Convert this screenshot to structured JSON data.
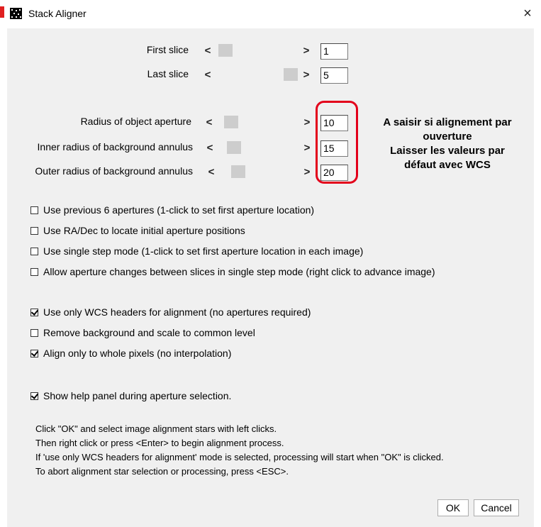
{
  "window": {
    "title": "Stack Aligner",
    "close_glyph": "×"
  },
  "slices": {
    "first_label": "First slice",
    "first_value": "1",
    "last_label": "Last slice",
    "last_value": "5",
    "prev_arrow": "<",
    "next_arrow": ">"
  },
  "apertures": {
    "radius_label": "Radius of object aperture",
    "radius_value": "10",
    "inner_label": "Inner radius of background annulus",
    "inner_value": "15",
    "outer_label": "Outer radius of background annulus",
    "outer_value": "20"
  },
  "annotation": {
    "line1": "A saisir si alignement par",
    "line2": "ouverture",
    "line3": "Laisser les valeurs par",
    "line4": "défaut avec WCS",
    "color": "#e3001b"
  },
  "options": [
    {
      "label": "Use previous 6 apertures (1-click to set first aperture location)",
      "checked": false
    },
    {
      "label": "Use RA/Dec to locate initial aperture positions",
      "checked": false
    },
    {
      "label": "Use single step mode (1-click to set first aperture location in each image)",
      "checked": false
    },
    {
      "label": "Allow aperture changes between slices in single step mode (right click to advance image)",
      "checked": false
    },
    {
      "label": "Use only WCS headers for alignment (no apertures required)",
      "checked": true
    },
    {
      "label": "Remove background and scale to common level",
      "checked": false
    },
    {
      "label": "Align only to whole pixels (no interpolation)",
      "checked": true
    },
    {
      "label": "Show help panel during aperture selection.",
      "checked": true
    }
  ],
  "help_text": [
    "Click \"OK\" and select image alignment stars with left clicks.",
    "Then right click or press <Enter> to begin alignment process.",
    "If 'use only WCS headers for alignment' mode is selected, processing will start when \"OK\" is clicked.",
    "To abort alignment star selection or processing, press <ESC>."
  ],
  "buttons": {
    "ok": "OK",
    "cancel": "Cancel"
  },
  "icons": {
    "app": "starfield-icon",
    "close": "close-icon",
    "checkbox": "checkbox-icon"
  }
}
